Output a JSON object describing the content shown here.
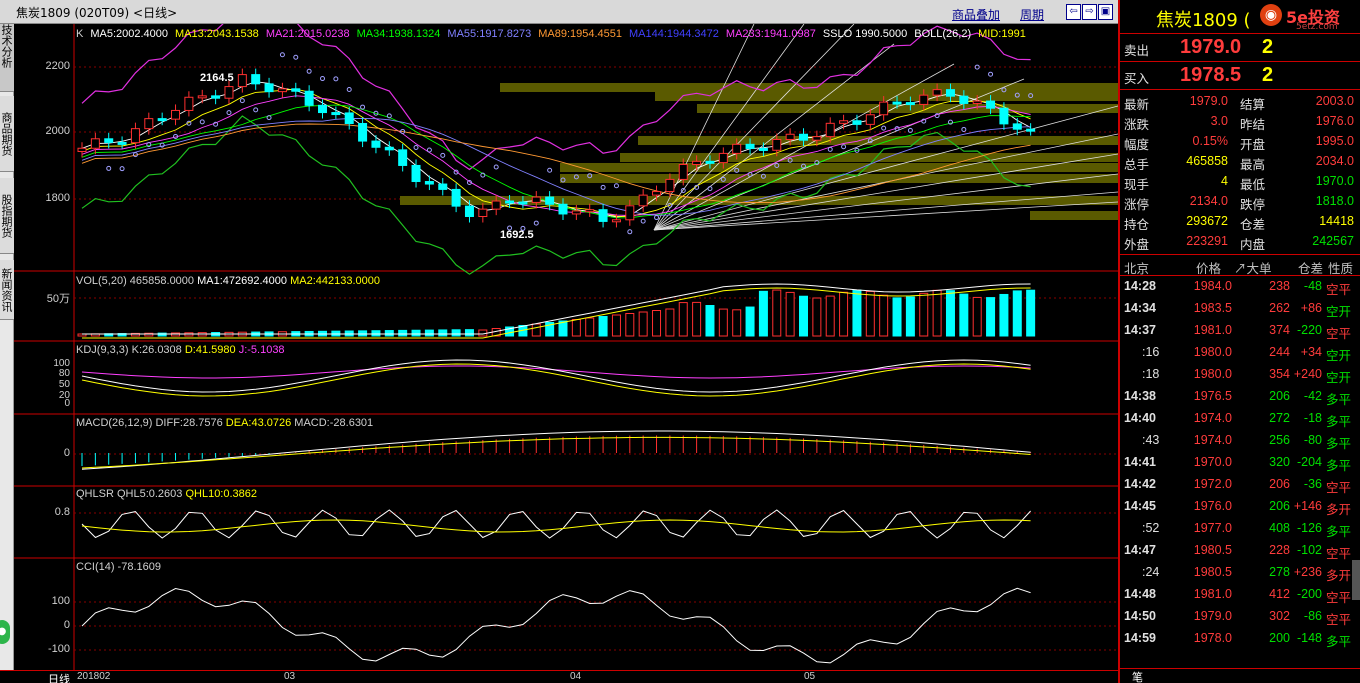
{
  "window": {
    "title": "焦炭1809 (020T09) <日线>",
    "link_overlay": "商品叠加",
    "link_period": "周期"
  },
  "left_tabs": [
    "技术分析",
    "商品期货",
    "股指期货",
    "新闻资讯"
  ],
  "main": {
    "ma_line": [
      {
        "t": "K",
        "c": "#d0d0d0"
      },
      {
        "t": "MA5:2002.4000",
        "c": "#ffffff"
      },
      {
        "t": "MA13:2043.1538",
        "c": "#ffff00"
      },
      {
        "t": "MA21:2015.0238",
        "c": "#ff40ff"
      },
      {
        "t": "MA34:1938.1324",
        "c": "#00ff00"
      },
      {
        "t": "MA55:1917.8273",
        "c": "#8080ff"
      },
      {
        "t": "MA89:1954.4551",
        "c": "#ff9933"
      },
      {
        "t": "MA144:1944.3472",
        "c": "#4040ff"
      },
      {
        "t": "MA233:1941.0987",
        "c": "#ff40ff"
      },
      {
        "t": "SSLO 1990.5000",
        "c": "#ffffff"
      },
      {
        "t": "BOLL(26,2)",
        "c": "#ffffff"
      },
      {
        "t": "MID:1991",
        "c": "#ffff00"
      }
    ],
    "yticks": [
      "2200",
      "2000",
      "1800"
    ],
    "high_label": "2164.5",
    "low_label": "1692.5"
  },
  "vol": {
    "title": "VOL(5,20) 465858.0000",
    "ma1": "MA1:472692.4000",
    "ma2": "MA2:442133.0000",
    "ytick": "50万"
  },
  "kdj": {
    "title": "KDJ(9,3,3) K:26.0308",
    "d": "D:41.5980",
    "j": "J:-5.1038",
    "yticks": [
      "100",
      "80",
      "50",
      "20",
      "0"
    ]
  },
  "macd": {
    "title": "MACD(26,12,9) DIFF:28.7576",
    "dea": "DEA:43.0726",
    "macd": "MACD:-28.6301",
    "ytick": "0"
  },
  "qhlsr": {
    "title": "QHLSR QHL5:0.2603",
    "ql10": "QHL10:0.3862",
    "ytick": "0.8"
  },
  "cci": {
    "title": "CCI(14) -78.1609",
    "yticks": [
      "100",
      "0",
      "-100"
    ]
  },
  "xaxis": {
    "period": "日线",
    "labels": [
      "201802",
      "03",
      "04",
      "05"
    ]
  },
  "panel": {
    "title": "焦炭1809 (",
    "logo": "5e投资",
    "logo_url": "5etz.com",
    "sell_label": "卖出",
    "sell_price": "1979.0",
    "sell_qty": "2",
    "buy_label": "买入",
    "buy_price": "1978.5",
    "buy_qty": "2",
    "stats": [
      [
        "最新",
        "1979.0",
        "结算",
        "2003.0"
      ],
      [
        "涨跌",
        "3.0",
        "昨结",
        "1976.0"
      ],
      [
        "幅度",
        "0.15%",
        "开盘",
        "1995.0"
      ],
      [
        "总手",
        "465858",
        "最高",
        "2034.0"
      ],
      [
        "现手",
        "4",
        "最低",
        "1970.0"
      ],
      [
        "涨停",
        "2134.0",
        "跌停",
        "1818.0"
      ],
      [
        "持仓",
        "293672",
        "仓差",
        "14418"
      ],
      [
        "外盘",
        "223291",
        "内盘",
        "242567"
      ]
    ],
    "tick_header": [
      "北京",
      "价格",
      "↗大单",
      "仓差",
      "性质"
    ],
    "ticks": [
      [
        "14:28",
        "1984.0",
        "238",
        "-48",
        "空平"
      ],
      [
        "14:34",
        "1983.5",
        "262",
        "+86",
        "空开"
      ],
      [
        "14:37",
        "1981.0",
        "374",
        "-220",
        "空平"
      ],
      [
        ":16",
        "1980.0",
        "244",
        "+34",
        "空开"
      ],
      [
        ":18",
        "1980.0",
        "354",
        "+240",
        "空开"
      ],
      [
        "14:38",
        "1976.5",
        "206",
        "-42",
        "多平"
      ],
      [
        "14:40",
        "1974.0",
        "272",
        "-18",
        "多平"
      ],
      [
        ":43",
        "1974.0",
        "256",
        "-80",
        "多平"
      ],
      [
        "14:41",
        "1970.0",
        "320",
        "-204",
        "多平"
      ],
      [
        "14:42",
        "1972.0",
        "206",
        "-36",
        "空平"
      ],
      [
        "14:45",
        "1976.0",
        "206",
        "+146",
        "多开"
      ],
      [
        ":52",
        "1977.0",
        "408",
        "-126",
        "多平"
      ],
      [
        "14:47",
        "1980.5",
        "228",
        "-102",
        "空平"
      ],
      [
        ":24",
        "1980.5",
        "278",
        "+236",
        "多开"
      ],
      [
        "14:48",
        "1981.0",
        "412",
        "-200",
        "空平"
      ],
      [
        "14:50",
        "1979.0",
        "302",
        "-86",
        "空平"
      ],
      [
        "14:59",
        "1978.0",
        "200",
        "-148",
        "多平"
      ]
    ],
    "bottom_tab": "笔"
  }
}
